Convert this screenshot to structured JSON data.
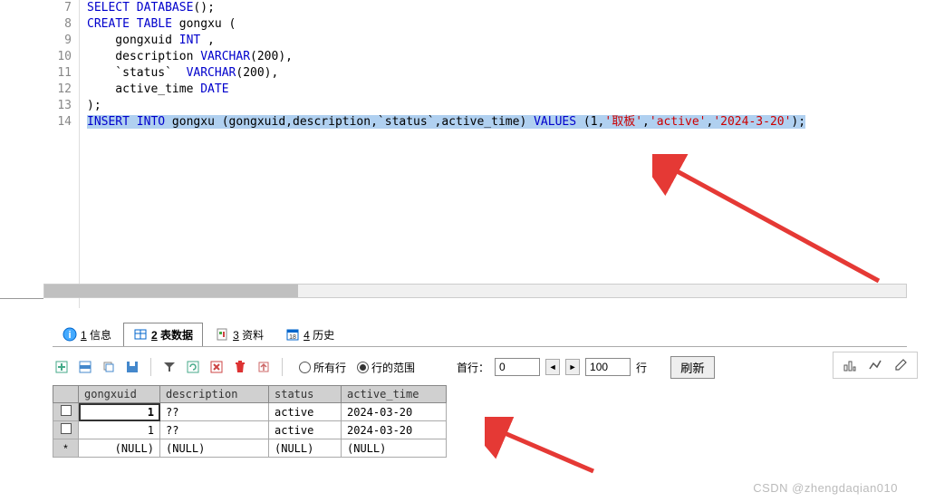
{
  "editor": {
    "lines": [
      {
        "num": "7",
        "html": "<span class='kw'>SELECT</span> <span class='kw'>DATABASE</span>();"
      },
      {
        "num": "8",
        "html": "<span class='kw'>CREATE</span> <span class='kw'>TABLE</span> gongxu ("
      },
      {
        "num": "9",
        "html": "    gongxuid <span class='type'>INT</span> ,"
      },
      {
        "num": "10",
        "html": "    description <span class='type'>VARCHAR</span>(200),"
      },
      {
        "num": "11",
        "html": "    `status`  <span class='type'>VARCHAR</span>(200),"
      },
      {
        "num": "12",
        "html": "    active_time <span class='type'>DATE</span>"
      },
      {
        "num": "13",
        "html": ");"
      },
      {
        "num": "14",
        "html": "<span class='highlight'><span class='kw'>INSERT</span> <span class='kw'>INTO</span> gongxu (gongxuid,description,`status`,active_time) <span class='kw'>VALUES</span> (1,<span class='str'>'取板'</span>,<span class='str'>'active'</span>,<span class='str'>'2024-3-20'</span>);</span>"
      }
    ]
  },
  "tabs": {
    "items": [
      {
        "key": "1",
        "label": "信息",
        "icon": "info-icon",
        "active": false
      },
      {
        "key": "2",
        "label": "表数据",
        "icon": "table-icon",
        "active": true
      },
      {
        "key": "3",
        "label": "资料",
        "icon": "doc-icon",
        "active": false
      },
      {
        "key": "4",
        "label": "历史",
        "icon": "calendar-icon",
        "active": false
      }
    ]
  },
  "toolbar": {
    "radio_all": "所有行",
    "radio_range": "行的范围",
    "first_row_label": "首行：",
    "first_row_value": "0",
    "limit_value": "100",
    "limit_label": "行",
    "refresh_label": "刷新"
  },
  "grid": {
    "headers": [
      "gongxuid",
      "description",
      "status",
      "active_time"
    ],
    "rows": [
      {
        "marker": "checkbox",
        "selected": true,
        "cells": [
          "1",
          "??",
          "active",
          "2024-03-20"
        ]
      },
      {
        "marker": "checkbox",
        "selected": false,
        "cells": [
          "1",
          "??",
          "active",
          "2024-03-20"
        ]
      },
      {
        "marker": "star",
        "selected": false,
        "cells": [
          "(NULL)",
          "(NULL)",
          "(NULL)",
          "(NULL)"
        ]
      }
    ]
  },
  "watermark": "CSDN @zhengdaqian010"
}
